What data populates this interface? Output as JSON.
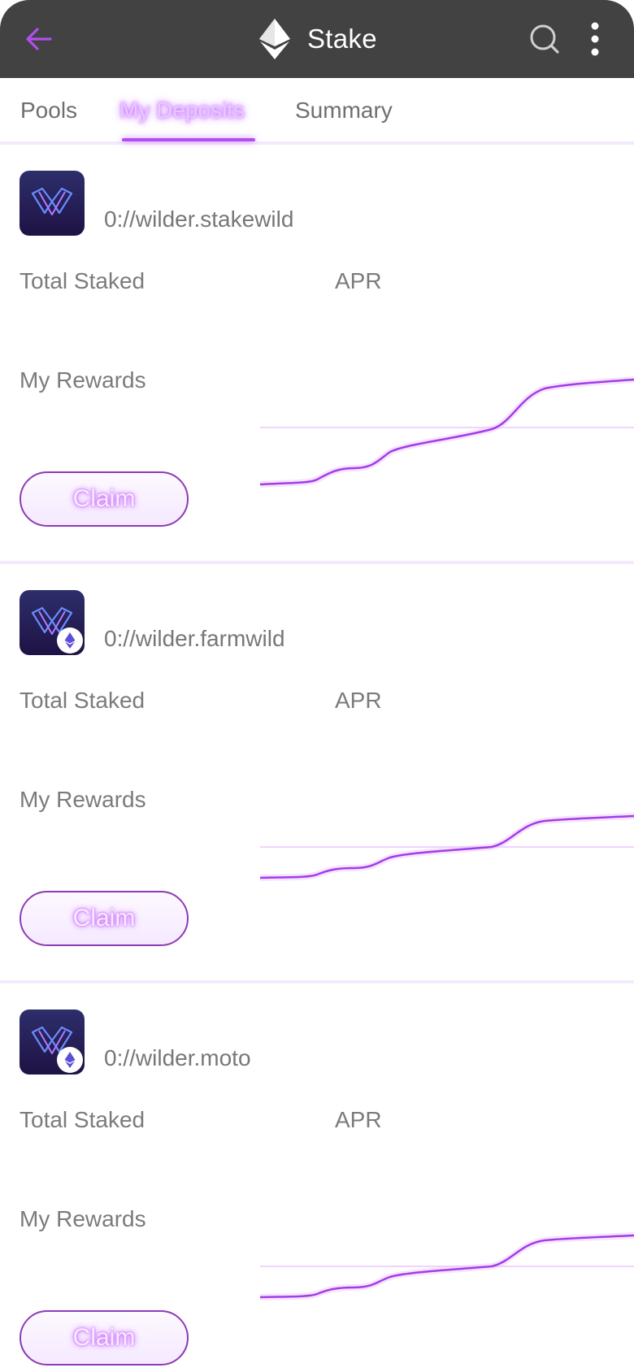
{
  "header": {
    "title": "Stake",
    "back_icon": "arrow-left-icon",
    "logo_icon": "ethereum-icon",
    "search_icon": "search-icon",
    "menu_icon": "more-vertical-icon",
    "accent_color": "#b14ef0",
    "background_color": "#424242"
  },
  "tabs": [
    {
      "label": "Pools",
      "active": false
    },
    {
      "label": "My Deposits",
      "active": true
    },
    {
      "label": "Summary",
      "active": false
    }
  ],
  "pools": [
    {
      "name": "0://wilder.stakewild",
      "has_eth_badge": false,
      "total_staked_label": "Total Staked",
      "apr_label": "APR",
      "rewards_label": "My Rewards",
      "claim_label": "Claim"
    },
    {
      "name": "0://wilder.farmwild",
      "has_eth_badge": true,
      "total_staked_label": "Total Staked",
      "apr_label": "APR",
      "rewards_label": "My Rewards",
      "claim_label": "Claim"
    },
    {
      "name": "0://wilder.moto",
      "has_eth_badge": true,
      "total_staked_label": "Total Staked",
      "apr_label": "APR",
      "rewards_label": "My Rewards",
      "claim_label": "Claim"
    }
  ]
}
